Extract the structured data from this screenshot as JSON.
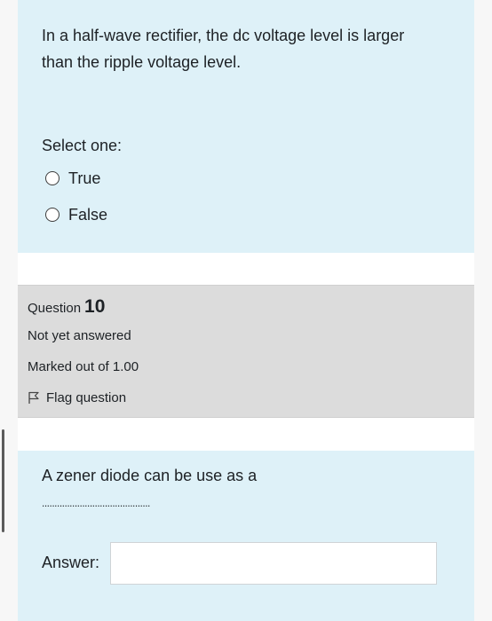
{
  "question9": {
    "text": "In a half-wave rectifier, the dc voltage level is larger than the ripple voltage level.",
    "select_label": "Select one:",
    "options": [
      {
        "label": "True"
      },
      {
        "label": "False"
      }
    ]
  },
  "question10_info": {
    "question_word": "Question",
    "number": "10",
    "state": "Not yet answered",
    "marked_out_of": "Marked out of 1.00",
    "flag_label": "Flag question"
  },
  "question10": {
    "text": "A zener diode can be use as a",
    "blank": "...........................................",
    "answer_label": "Answer:",
    "answer_value": ""
  },
  "colors": {
    "question_bg": "#def1f8",
    "info_bg": "#dcdcdc",
    "text": "#1d2125"
  }
}
